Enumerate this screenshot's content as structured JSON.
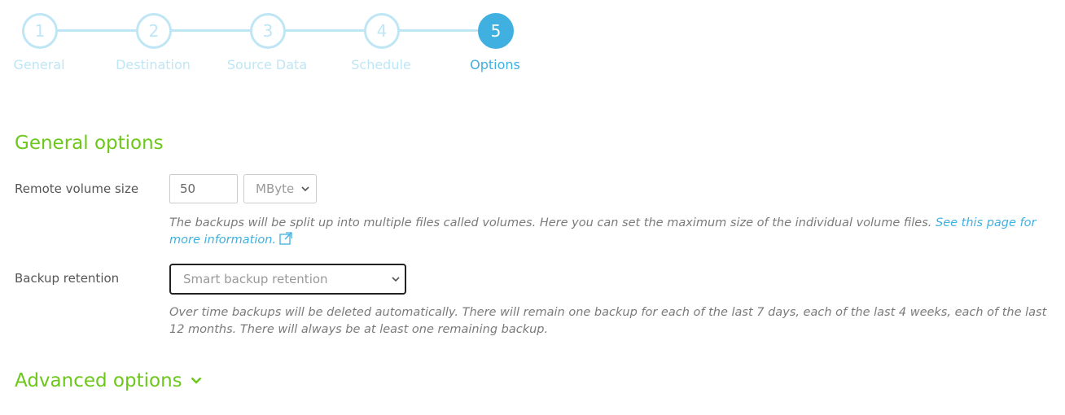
{
  "stepper": {
    "steps": [
      {
        "number": "1",
        "label": "General"
      },
      {
        "number": "2",
        "label": "Destination"
      },
      {
        "number": "3",
        "label": "Source Data"
      },
      {
        "number": "4",
        "label": "Schedule"
      },
      {
        "number": "5",
        "label": "Options"
      }
    ],
    "active_step": "5"
  },
  "general_options": {
    "title": "General options",
    "remote_volume": {
      "label": "Remote volume size",
      "value": "50",
      "unit": "MByte",
      "help_text": "The backups will be split up into multiple files called volumes. Here you can set the maximum size of the individual volume files. ",
      "help_link": "See this page for more information."
    },
    "backup_retention": {
      "label": "Backup retention",
      "selected": "Smart backup retention",
      "help_text": "Over time backups will be deleted automatically. There will remain one backup for each of the last 7 days, each of the last 4 weeks, each of the last 12 months. There will always be at least one remaining backup."
    }
  },
  "advanced_options": {
    "title": "Advanced options"
  },
  "colors": {
    "accent_blue": "#3fb0e0",
    "inactive_blue": "#bfe6f5",
    "section_green": "#6cc71a"
  }
}
